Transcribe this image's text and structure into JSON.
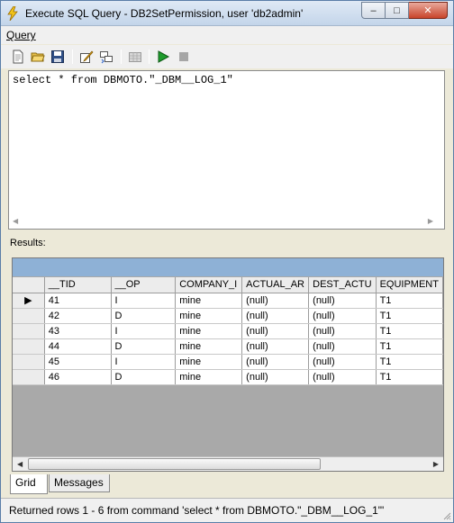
{
  "window": {
    "title": "Execute SQL Query - DB2SetPermission, user 'db2admin'",
    "close_glyph": "✕",
    "max_glyph": "□",
    "min_glyph": "–"
  },
  "menu": {
    "items": [
      {
        "label": "Query"
      }
    ]
  },
  "toolbar": {
    "buttons": [
      "new-document-icon",
      "open-folder-icon",
      "save-icon",
      "edit-icon",
      "replace-icon",
      "disabled-grid-icon",
      "run-icon",
      "stop-icon"
    ]
  },
  "editor": {
    "sql": "select * from DBMOTO.\"_DBM__LOG_1\""
  },
  "results": {
    "label": "Results:",
    "columns": [
      "__TID",
      "__OP",
      "COMPANY_I",
      "ACTUAL_AR",
      "DEST_ACTU",
      "EQUIPMENT"
    ],
    "rows": [
      [
        "41",
        "I",
        "mine",
        "(null)",
        "(null)",
        "T1"
      ],
      [
        "42",
        "D",
        "mine",
        "(null)",
        "(null)",
        "T1"
      ],
      [
        "43",
        "I",
        "mine",
        "(null)",
        "(null)",
        "T1"
      ],
      [
        "44",
        "D",
        "mine",
        "(null)",
        "(null)",
        "T1"
      ],
      [
        "45",
        "I",
        "mine",
        "(null)",
        "(null)",
        "T1"
      ],
      [
        "46",
        "D",
        "mine",
        "(null)",
        "(null)",
        "T1"
      ]
    ],
    "current_row_marker": "▶"
  },
  "tabs": [
    {
      "label": "Grid",
      "active": true
    },
    {
      "label": "Messages",
      "active": false
    }
  ],
  "status": {
    "text": "Returned rows 1 - 6 from command 'select * from DBMOTO.\"_DBM__LOG_1\"'"
  },
  "colors": {
    "title_gradient_top": "#dfe9f5",
    "grid_caption": "#8eb1d6",
    "run_icon": "#1e9c2c",
    "close_button": "#c8442a"
  }
}
